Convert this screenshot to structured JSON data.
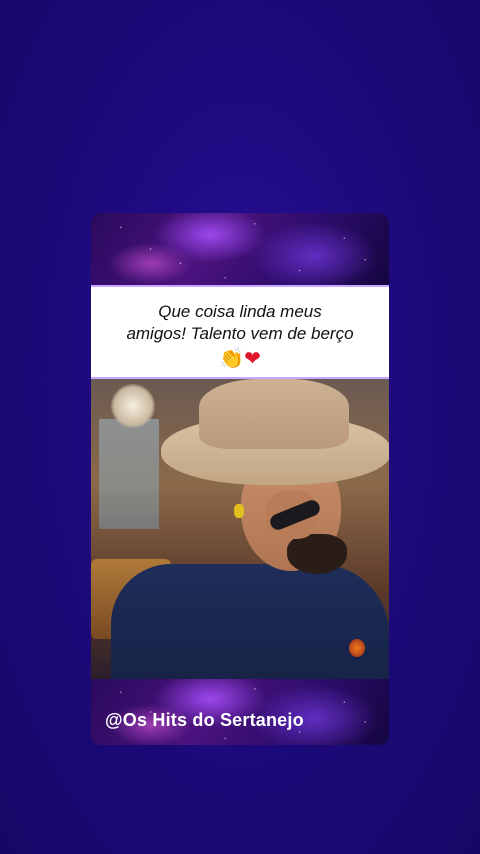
{
  "card": {
    "caption_line1": "Que coisa linda meus",
    "caption_line2": "amigos! Talento vem de berço",
    "emojis": {
      "clap": "👏",
      "heart": "❤"
    },
    "handle": "@Os Hits do Sertanejo"
  },
  "colors": {
    "background": "#1e0a7e",
    "caption_background": "#ffffff",
    "caption_border": "#c9a6ff",
    "handle_text": "#ffffff"
  },
  "icons": [
    "clapping-hands-icon",
    "red-heart-icon"
  ]
}
